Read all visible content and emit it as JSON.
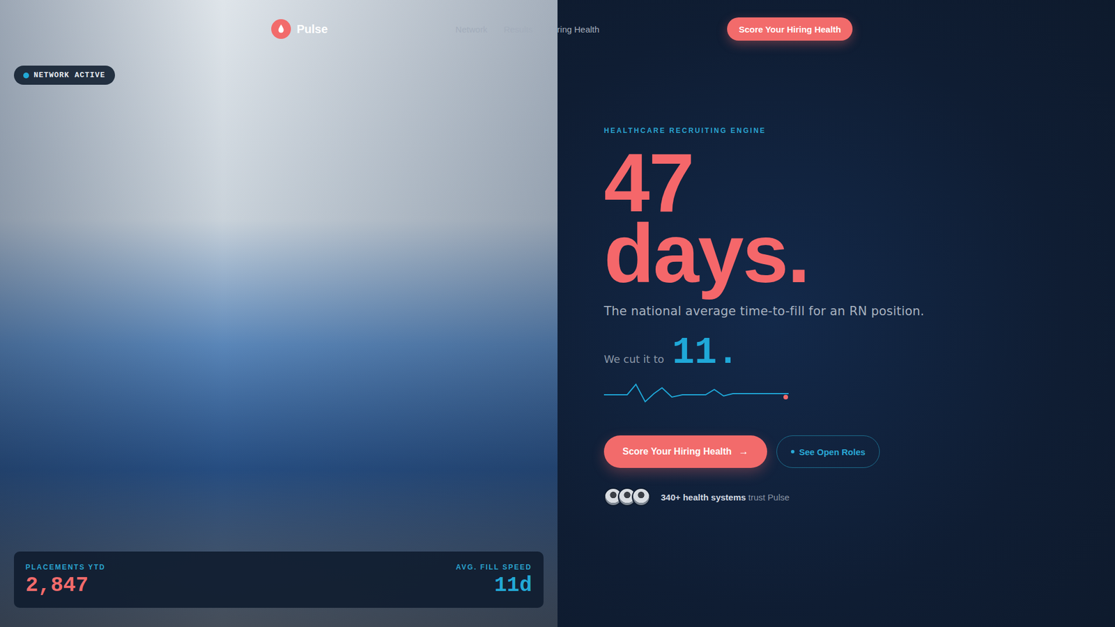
{
  "brand": {
    "name": "Pulse"
  },
  "nav": {
    "links": [
      {
        "label": "Network",
        "selected": false
      },
      {
        "label": "Results",
        "selected": false
      },
      {
        "label": "Hiring Health",
        "selected": false
      }
    ],
    "cta": "Score Your Hiring Health"
  },
  "status_badge": {
    "label": "NETWORK ACTIVE",
    "active": true
  },
  "stats": [
    {
      "label": "PLACEMENTS YTD",
      "value": "2,847",
      "color": "#f26b6b"
    },
    {
      "label": "AVG. FILL SPEED",
      "value": "11d",
      "color": "#22a9d6"
    }
  ],
  "hero": {
    "eyebrow": "HEALTHCARE RECRUITING ENGINE",
    "number": "47",
    "unit": "days.",
    "subtitle": "The national average time-to-fill for an RN position.",
    "compare_prefix": "We cut it to",
    "compare_value": "11."
  },
  "actions": {
    "primary": "Score Your Hiring Health",
    "primary_icon": "→",
    "secondary": "See Open Roles"
  },
  "trust": {
    "avatars": 3,
    "highlight": "340+ health systems",
    "suffix": "trust Pulse"
  }
}
